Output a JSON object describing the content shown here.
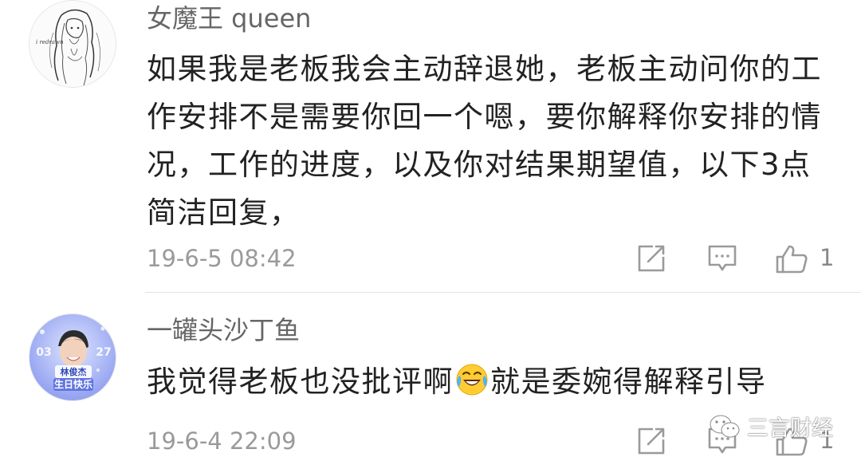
{
  "comments": [
    {
      "username": "女魔王 queen",
      "text": "如果我是老板我会主动辞退她，老板主动问你的工作安排不是需要你回一个嗯，要你解释你安排的情况，工作的进度，以及你对结果期望值，以下3点简洁回复，",
      "time": "19-6-5 08:42",
      "likes": "1",
      "avatar_caption": "i redrawn",
      "avatar_icon": "anime-girl-sketch-avatar"
    },
    {
      "username": "一罐头沙丁鱼",
      "text_before": "我觉得老板也没批评啊",
      "emoji": "laughing-tears-emoji",
      "text_after": "就是委婉得解释引导",
      "time": "19-6-4 22:09",
      "likes": "1",
      "avatar_name": "林俊杰",
      "avatar_greeting": "生日快乐",
      "avatar_num_left": "03",
      "avatar_num_right": "27",
      "avatar_icon": "birthday-portrait-avatar"
    }
  ],
  "watermark": {
    "label": "三言财经",
    "icon": "wechat-official-account-icon"
  },
  "colors": {
    "username": "#666666",
    "text": "#222222",
    "time": "#9a9a9a",
    "icon": "#9a9a9a",
    "divider": "#e3e3e3"
  }
}
